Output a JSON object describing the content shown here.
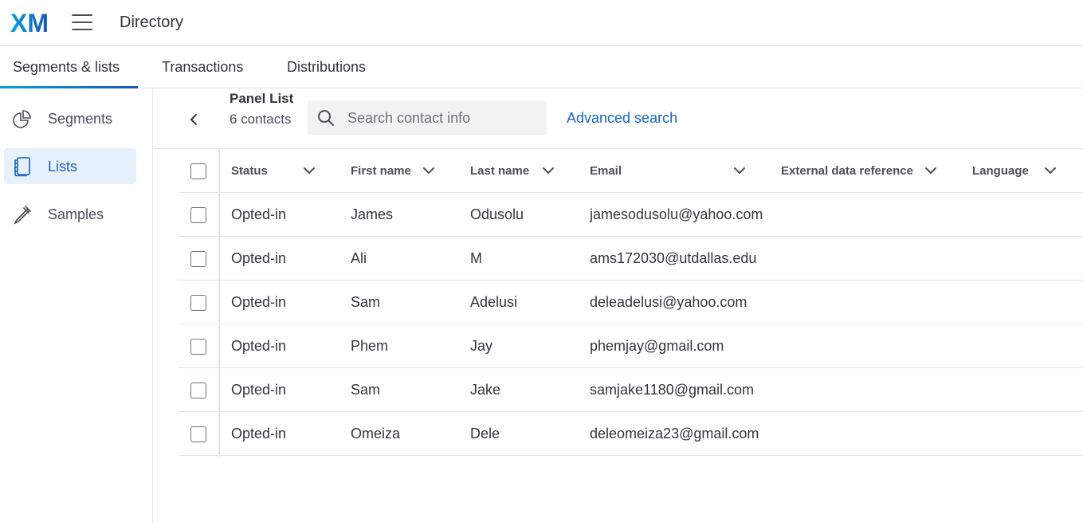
{
  "app": {
    "logo_text": "XM",
    "title": "Directory"
  },
  "colors": {
    "accent": "#1b64c0",
    "active_bg": "#e6f1fb",
    "logo_start": "#08a0d9",
    "logo_end": "#1c56b8"
  },
  "tabs": [
    {
      "label": "Segments & lists",
      "active": true
    },
    {
      "label": "Transactions",
      "active": false
    },
    {
      "label": "Distributions",
      "active": false
    }
  ],
  "sidebar": {
    "items": [
      {
        "label": "Segments",
        "icon": "pie-chart-icon",
        "active": false
      },
      {
        "label": "Lists",
        "icon": "notebook-icon",
        "active": true
      },
      {
        "label": "Samples",
        "icon": "pipette-icon",
        "active": false
      }
    ]
  },
  "list": {
    "title": "Panel List",
    "count": "6 contacts",
    "search_placeholder": "Search contact info",
    "advanced_search": "Advanced search"
  },
  "table": {
    "columns": [
      "Status",
      "First name",
      "Last name",
      "Email",
      "External data reference",
      "Language"
    ],
    "rows": [
      {
        "status": "Opted-in",
        "first": "James",
        "last": "Odusolu",
        "email": "jamesodusolu@yahoo.com",
        "ext": "",
        "lang": ""
      },
      {
        "status": "Opted-in",
        "first": "Ali",
        "last": "M",
        "email": "ams172030@utdallas.edu",
        "ext": "",
        "lang": ""
      },
      {
        "status": "Opted-in",
        "first": "Sam",
        "last": "Adelusi",
        "email": "deleadelusi@yahoo.com",
        "ext": "",
        "lang": ""
      },
      {
        "status": "Opted-in",
        "first": "Phem",
        "last": "Jay",
        "email": "phemjay@gmail.com",
        "ext": "",
        "lang": ""
      },
      {
        "status": "Opted-in",
        "first": "Sam",
        "last": "Jake",
        "email": "samjake1180@gmail.com",
        "ext": "",
        "lang": ""
      },
      {
        "status": "Opted-in",
        "first": "Omeiza",
        "last": "Dele",
        "email": "deleomeiza23@gmail.com",
        "ext": "",
        "lang": ""
      }
    ]
  }
}
